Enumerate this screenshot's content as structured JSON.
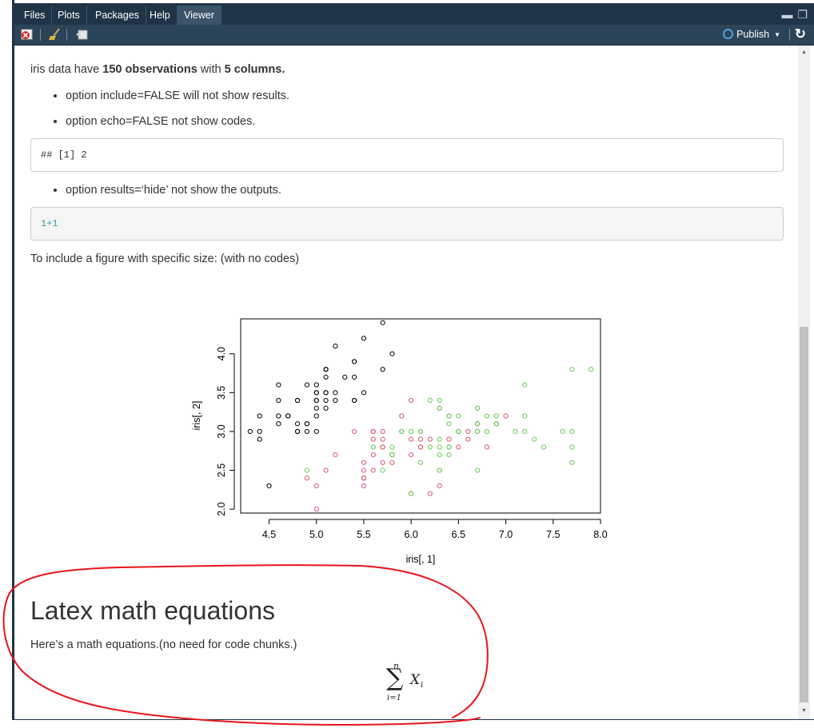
{
  "tabs": [
    {
      "label": "Files",
      "active": false
    },
    {
      "label": "Plots",
      "active": false
    },
    {
      "label": "Packages",
      "active": false
    },
    {
      "label": "Help",
      "active": false
    },
    {
      "label": "Viewer",
      "active": true
    }
  ],
  "toolbar": {
    "icons": [
      "clear-viewer-icon",
      "broom-icon",
      "export-icon"
    ],
    "publish_label": "Publish",
    "refresh_icon": "refresh-icon"
  },
  "doc": {
    "intro_pre": "iris data have ",
    "intro_obs": "150 observations",
    "intro_mid": " with ",
    "intro_cols": "5 columns.",
    "bullet_include": "option include=FALSE will not show results.",
    "bullet_echo": "option echo=FALSE not show codes.",
    "code_output": "## [1] 2",
    "bullet_results": "option results=‘hide’ not show the outputs.",
    "code_source": "1+1",
    "figure_intro": "To include a figure with specific size: (with no codes)",
    "heading": "Latex math equations",
    "math_intro": "Here’s a math equations.(no need for code chunks.)",
    "eq_upper": "n",
    "eq_sum": "∑",
    "eq_lower": "i=1",
    "eq_term": "X",
    "eq_sub": "i"
  },
  "colors": {
    "tabbar": "#1f3447",
    "toolbar": "#2c4458",
    "annotation": "#e8141b",
    "setosa": "#000000",
    "versicolor": "#df536b",
    "virginica": "#61d04f"
  },
  "chart_data": {
    "type": "scatter",
    "xlabel": "iris[, 1]",
    "ylabel": "iris[, 2]",
    "xlim": [
      4.2,
      8.0
    ],
    "ylim": [
      1.95,
      4.45
    ],
    "xticks": [
      "4.5",
      "5.0",
      "5.5",
      "6.0",
      "6.5",
      "7.0",
      "7.5",
      "8.0"
    ],
    "yticks": [
      "2.0",
      "2.5",
      "3.0",
      "3.5",
      "4.0"
    ],
    "series": [
      {
        "color": "#000000",
        "points": [
          [
            5.1,
            3.5
          ],
          [
            4.9,
            3.0
          ],
          [
            4.7,
            3.2
          ],
          [
            4.6,
            3.1
          ],
          [
            5.0,
            3.6
          ],
          [
            5.4,
            3.9
          ],
          [
            4.6,
            3.4
          ],
          [
            5.0,
            3.4
          ],
          [
            4.4,
            2.9
          ],
          [
            4.9,
            3.1
          ],
          [
            5.4,
            3.7
          ],
          [
            4.8,
            3.4
          ],
          [
            4.8,
            3.0
          ],
          [
            4.3,
            3.0
          ],
          [
            5.8,
            4.0
          ],
          [
            5.7,
            4.4
          ],
          [
            5.4,
            3.9
          ],
          [
            5.1,
            3.5
          ],
          [
            5.7,
            3.8
          ],
          [
            5.1,
            3.8
          ],
          [
            5.4,
            3.4
          ],
          [
            5.1,
            3.7
          ],
          [
            4.6,
            3.6
          ],
          [
            5.1,
            3.3
          ],
          [
            4.8,
            3.4
          ],
          [
            5.0,
            3.0
          ],
          [
            5.0,
            3.4
          ],
          [
            5.2,
            3.5
          ],
          [
            5.2,
            3.4
          ],
          [
            4.7,
            3.2
          ],
          [
            4.8,
            3.1
          ],
          [
            5.4,
            3.4
          ],
          [
            5.2,
            4.1
          ],
          [
            5.5,
            4.2
          ],
          [
            4.9,
            3.1
          ],
          [
            5.0,
            3.2
          ],
          [
            5.5,
            3.5
          ],
          [
            4.9,
            3.6
          ],
          [
            4.4,
            3.0
          ],
          [
            5.1,
            3.4
          ],
          [
            5.0,
            3.5
          ],
          [
            4.5,
            2.3
          ],
          [
            4.4,
            3.2
          ],
          [
            5.0,
            3.5
          ],
          [
            5.1,
            3.8
          ],
          [
            4.8,
            3.0
          ],
          [
            5.1,
            3.8
          ],
          [
            4.6,
            3.2
          ],
          [
            5.3,
            3.7
          ],
          [
            5.0,
            3.3
          ]
        ]
      },
      {
        "color": "#df536b",
        "points": [
          [
            7.0,
            3.2
          ],
          [
            6.4,
            3.2
          ],
          [
            6.9,
            3.1
          ],
          [
            5.5,
            2.3
          ],
          [
            6.5,
            2.8
          ],
          [
            5.7,
            2.8
          ],
          [
            6.3,
            3.3
          ],
          [
            4.9,
            2.4
          ],
          [
            6.6,
            2.9
          ],
          [
            5.2,
            2.7
          ],
          [
            5.0,
            2.0
          ],
          [
            5.9,
            3.0
          ],
          [
            6.0,
            2.2
          ],
          [
            6.1,
            2.9
          ],
          [
            5.6,
            2.9
          ],
          [
            6.7,
            3.1
          ],
          [
            5.6,
            3.0
          ],
          [
            5.8,
            2.7
          ],
          [
            6.2,
            2.2
          ],
          [
            5.6,
            2.5
          ],
          [
            5.9,
            3.2
          ],
          [
            6.1,
            2.8
          ],
          [
            6.3,
            2.5
          ],
          [
            6.1,
            2.8
          ],
          [
            6.4,
            2.9
          ],
          [
            6.6,
            3.0
          ],
          [
            6.8,
            2.8
          ],
          [
            6.7,
            3.0
          ],
          [
            6.0,
            2.9
          ],
          [
            5.7,
            2.6
          ],
          [
            5.5,
            2.4
          ],
          [
            5.5,
            2.4
          ],
          [
            5.8,
            2.7
          ],
          [
            6.0,
            2.7
          ],
          [
            5.4,
            3.0
          ],
          [
            6.0,
            3.4
          ],
          [
            6.7,
            3.1
          ],
          [
            6.3,
            2.3
          ],
          [
            5.6,
            3.0
          ],
          [
            5.5,
            2.5
          ],
          [
            5.5,
            2.6
          ],
          [
            6.1,
            3.0
          ],
          [
            5.8,
            2.6
          ],
          [
            5.0,
            2.3
          ],
          [
            5.6,
            2.7
          ],
          [
            5.7,
            3.0
          ],
          [
            5.7,
            2.9
          ],
          [
            6.2,
            2.9
          ],
          [
            5.1,
            2.5
          ],
          [
            5.7,
            2.8
          ]
        ]
      },
      {
        "color": "#61d04f",
        "points": [
          [
            6.3,
            3.3
          ],
          [
            5.8,
            2.7
          ],
          [
            7.1,
            3.0
          ],
          [
            6.3,
            2.9
          ],
          [
            6.5,
            3.0
          ],
          [
            7.6,
            3.0
          ],
          [
            4.9,
            2.5
          ],
          [
            7.3,
            2.9
          ],
          [
            6.7,
            2.5
          ],
          [
            7.2,
            3.6
          ],
          [
            6.5,
            3.2
          ],
          [
            6.4,
            2.7
          ],
          [
            6.8,
            3.0
          ],
          [
            5.7,
            2.5
          ],
          [
            5.8,
            2.8
          ],
          [
            6.4,
            3.2
          ],
          [
            6.5,
            3.0
          ],
          [
            7.7,
            3.8
          ],
          [
            7.7,
            2.6
          ],
          [
            6.0,
            2.2
          ],
          [
            6.9,
            3.2
          ],
          [
            5.6,
            2.8
          ],
          [
            7.7,
            2.8
          ],
          [
            6.3,
            2.7
          ],
          [
            6.7,
            3.3
          ],
          [
            7.2,
            3.2
          ],
          [
            6.2,
            2.8
          ],
          [
            6.1,
            3.0
          ],
          [
            6.4,
            2.8
          ],
          [
            7.2,
            3.0
          ],
          [
            7.4,
            2.8
          ],
          [
            7.9,
            3.8
          ],
          [
            6.4,
            2.8
          ],
          [
            6.3,
            2.8
          ],
          [
            6.1,
            2.6
          ],
          [
            7.7,
            3.0
          ],
          [
            6.3,
            3.4
          ],
          [
            6.4,
            3.1
          ],
          [
            6.0,
            3.0
          ],
          [
            6.9,
            3.1
          ],
          [
            6.7,
            3.1
          ],
          [
            6.9,
            3.1
          ],
          [
            5.8,
            2.7
          ],
          [
            6.8,
            3.2
          ],
          [
            6.7,
            3.3
          ],
          [
            6.7,
            3.0
          ],
          [
            6.3,
            2.5
          ],
          [
            6.5,
            3.0
          ],
          [
            6.2,
            3.4
          ],
          [
            5.9,
            3.0
          ]
        ]
      }
    ]
  }
}
